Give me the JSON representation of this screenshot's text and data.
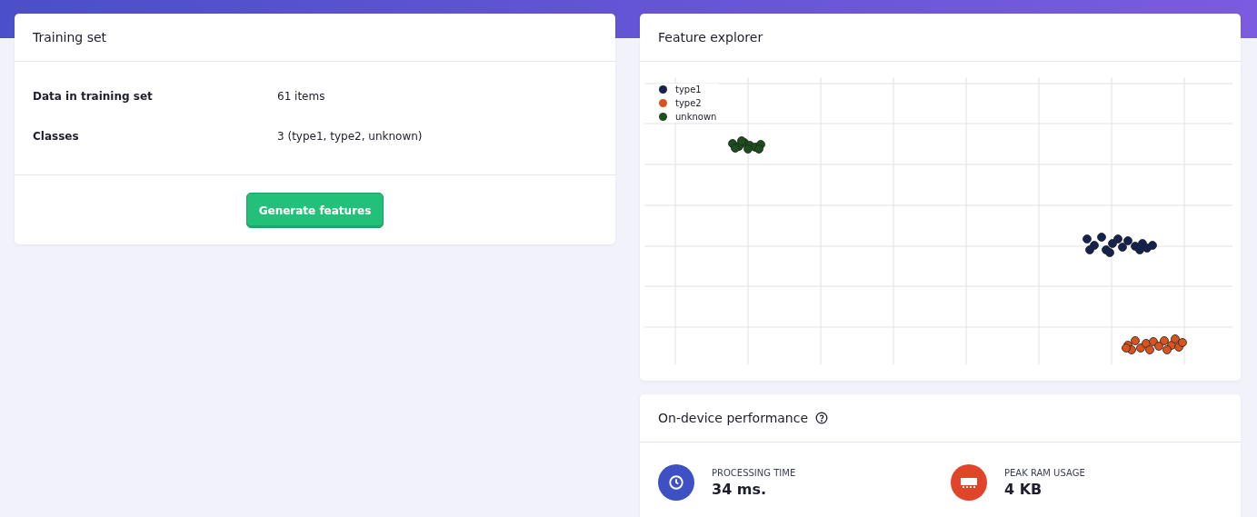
{
  "training_set": {
    "title": "Training set",
    "rows": [
      {
        "label": "Data in training set",
        "value": "61 items"
      },
      {
        "label": "Classes",
        "value": "3 (type1, type2, unknown)"
      }
    ],
    "button": "Generate features"
  },
  "feature_explorer": {
    "title": "Feature explorer",
    "legend": [
      {
        "label": "type1",
        "color": "#14224f"
      },
      {
        "label": "type2",
        "color": "#d9531e"
      },
      {
        "label": "unknown",
        "color": "#1e4d1e"
      }
    ]
  },
  "performance": {
    "title": "On-device performance",
    "metrics": [
      {
        "kind": "time",
        "label": "PROCESSING TIME",
        "value": "34 ms."
      },
      {
        "kind": "memory",
        "label": "PEAK RAM USAGE",
        "value": "4 KB"
      }
    ]
  }
}
